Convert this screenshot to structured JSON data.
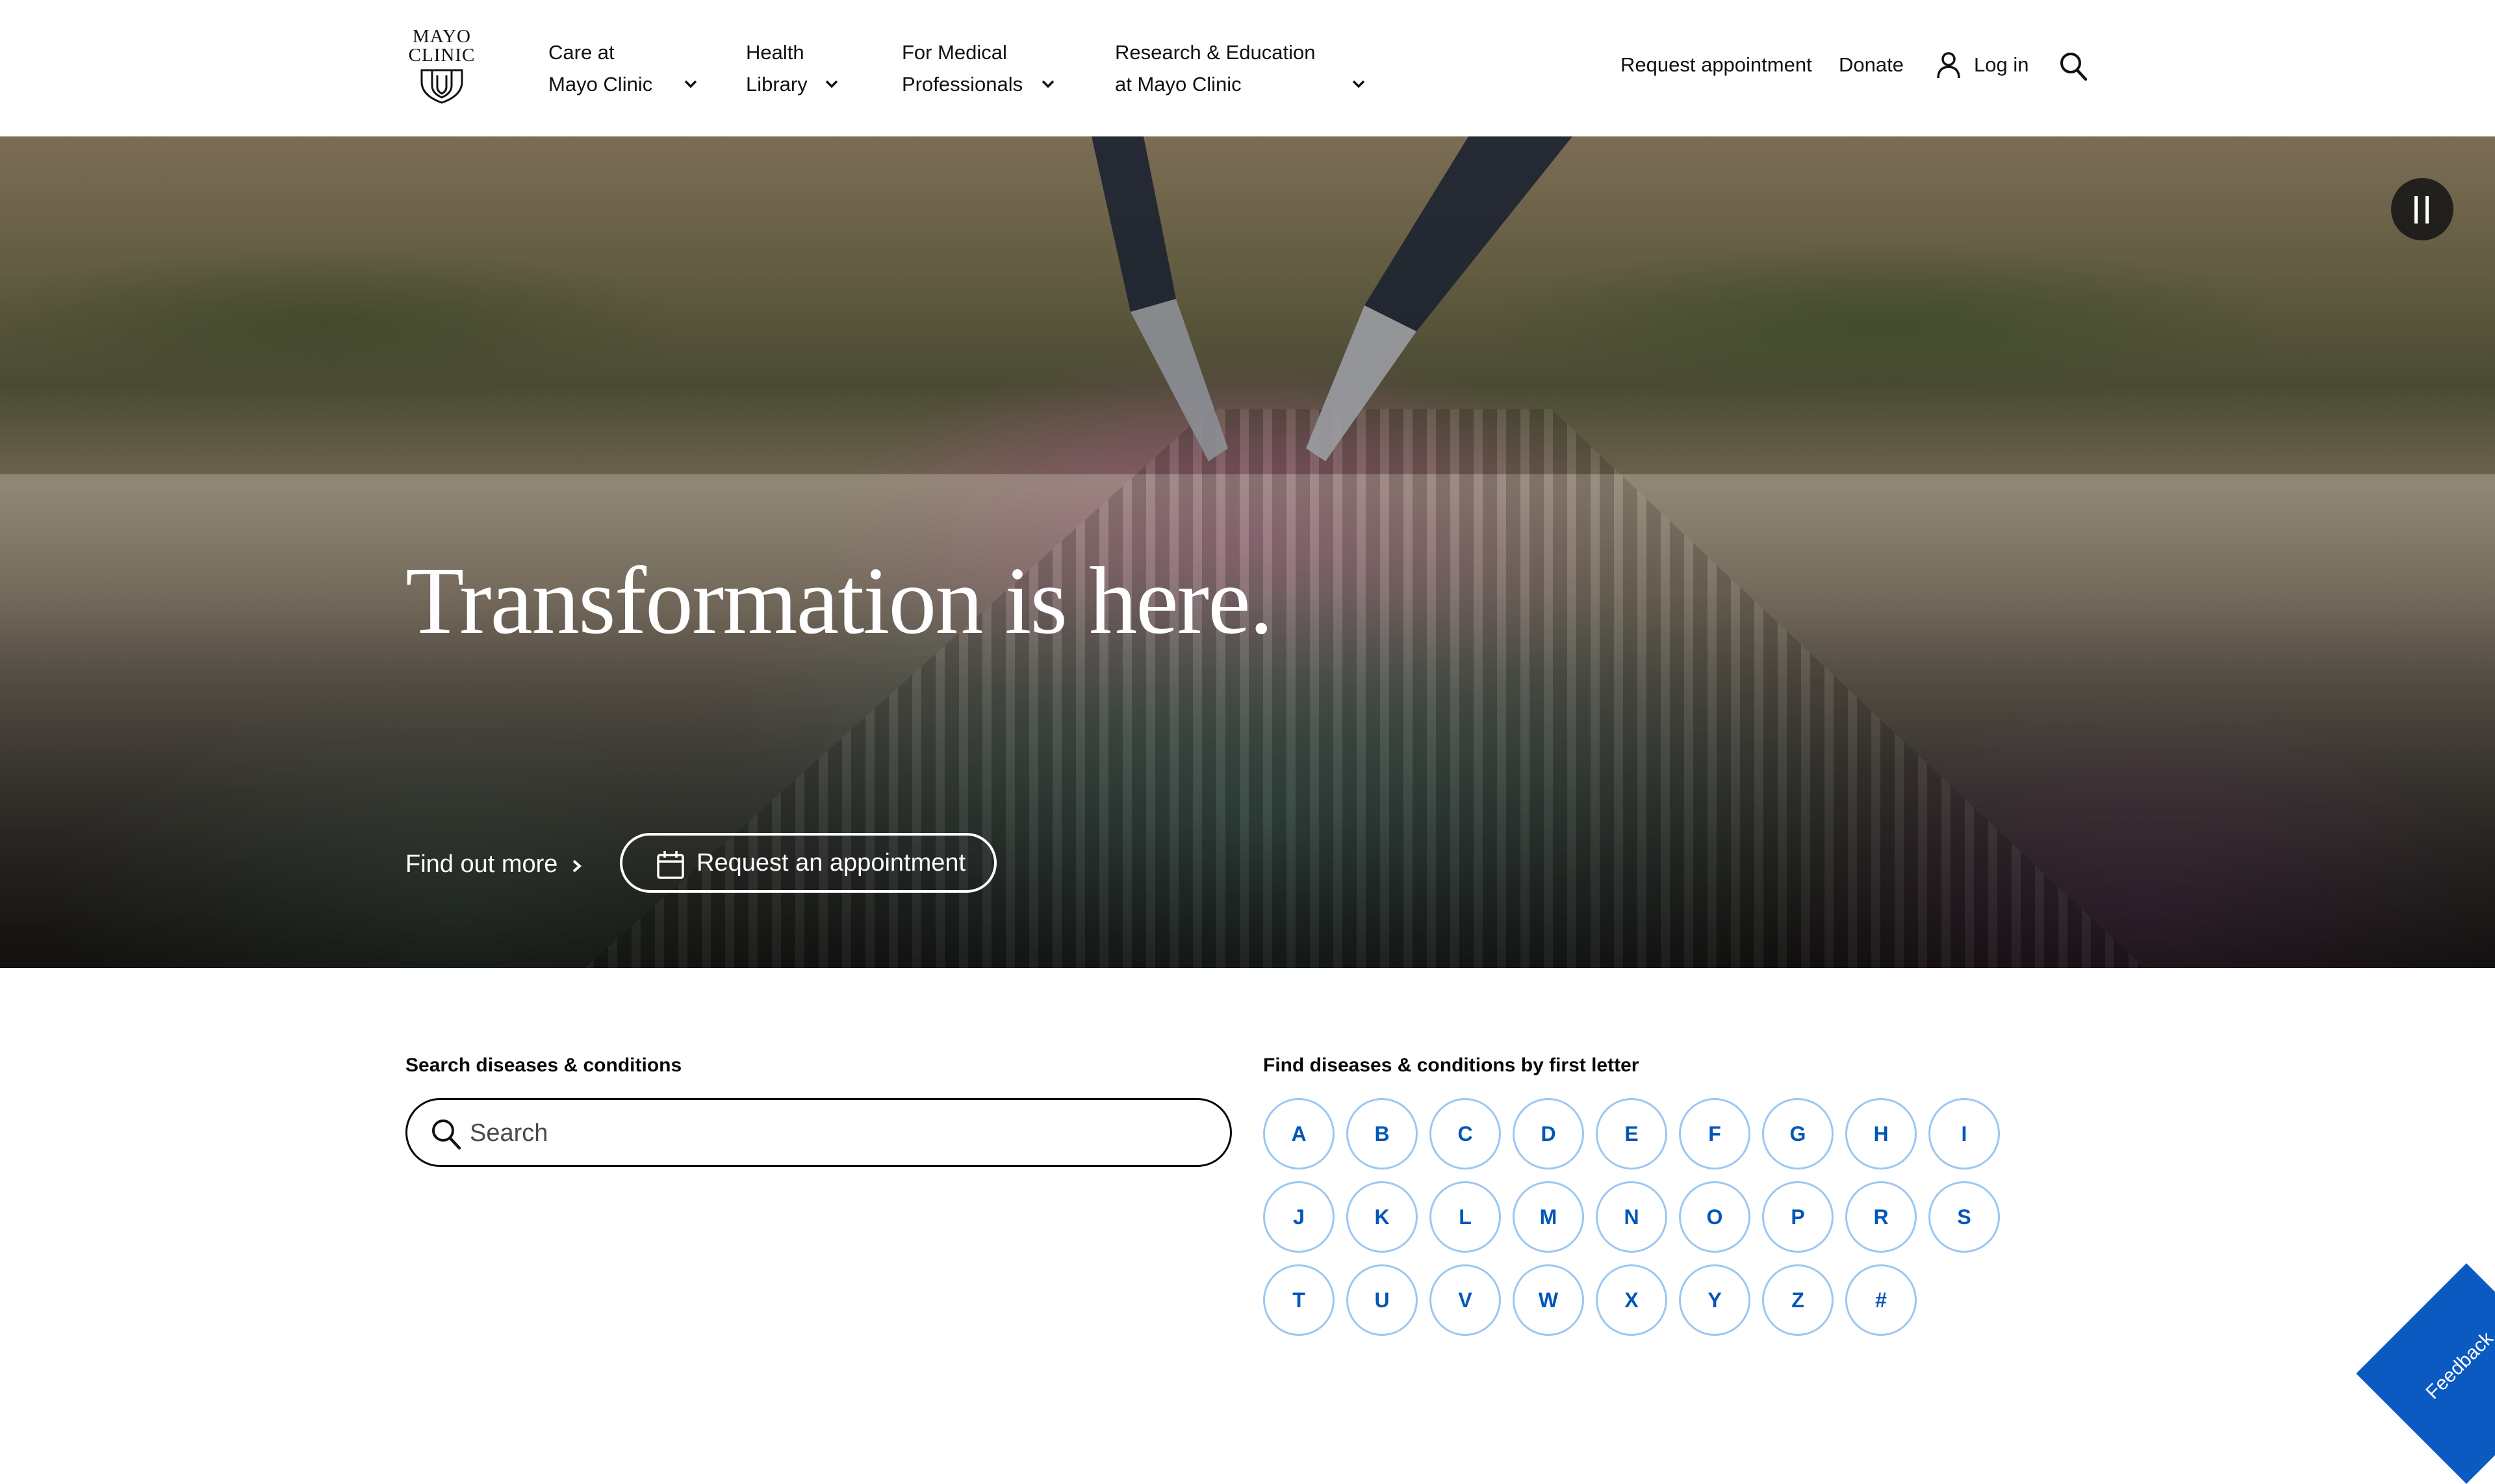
{
  "logo": {
    "line1": "MAYO",
    "line2": "CLINIC"
  },
  "nav": [
    {
      "line1": "Care at",
      "line2": "Mayo Clinic"
    },
    {
      "line1": "Health",
      "line2": "Library"
    },
    {
      "line1": "For Medical",
      "line2": "Professionals"
    },
    {
      "line1": "Research & Education",
      "line2": "at Mayo Clinic"
    }
  ],
  "utility": {
    "request_appointment": "Request appointment",
    "donate": "Donate",
    "login": "Log in"
  },
  "hero": {
    "title": "Transformation is here.",
    "find_more": "Find out more",
    "appointment_button": "Request an appointment"
  },
  "search": {
    "label": "Search diseases & conditions",
    "placeholder": "Search"
  },
  "letters": {
    "label": "Find diseases & conditions by first letter",
    "items": [
      "A",
      "B",
      "C",
      "D",
      "E",
      "F",
      "G",
      "H",
      "I",
      "J",
      "K",
      "L",
      "M",
      "N",
      "O",
      "P",
      "R",
      "S",
      "T",
      "U",
      "V",
      "W",
      "X",
      "Y",
      "Z",
      "#"
    ]
  },
  "feedback": "Feedback",
  "colors": {
    "link_blue": "#0057b8",
    "letter_border": "#9cc7f2",
    "feedback_bg": "#0a5ac2"
  },
  "icons": [
    "mayo-shield-icon",
    "chevron-down-icon",
    "user-icon",
    "search-icon",
    "pause-icon",
    "chevron-right-icon",
    "calendar-icon"
  ]
}
